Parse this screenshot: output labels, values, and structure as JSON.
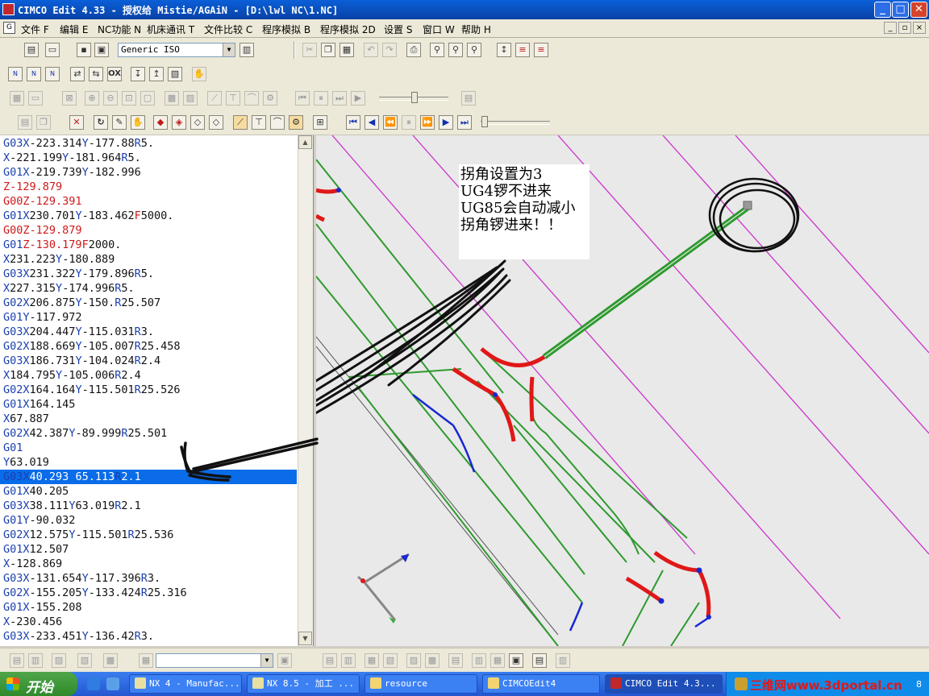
{
  "window": {
    "title": "CIMCO Edit 4.33 - 授权给 Mistie/AGAiN - [D:\\lwl NC\\1.NC]",
    "controls": {
      "minimize": "_",
      "maximize": "□",
      "close": "✕"
    }
  },
  "menubar": {
    "items": [
      "文件 F",
      "编辑 E",
      "NC功能 N",
      "机床通讯 T",
      "文件比较 C",
      "程序模拟 B",
      "程序模拟 2D",
      "设置 S",
      "窗口 W",
      "帮助 H"
    ]
  },
  "toolbar": {
    "machine_select": "Generic ISO",
    "bottom_combo": ""
  },
  "editor": {
    "selected_index": 23,
    "lines": [
      [
        [
          "G03",
          "b"
        ],
        [
          "X",
          "b"
        ],
        [
          "-223.314",
          "n"
        ],
        [
          "Y",
          "b"
        ],
        [
          "-177.88",
          "n"
        ],
        [
          "R",
          "b"
        ],
        [
          "5.",
          "n"
        ]
      ],
      [
        [
          "X",
          "b"
        ],
        [
          "-221.199",
          "n"
        ],
        [
          "Y",
          "b"
        ],
        [
          "-181.964",
          "n"
        ],
        [
          "R",
          "b"
        ],
        [
          "5.",
          "n"
        ]
      ],
      [
        [
          "G01",
          "b"
        ],
        [
          "X",
          "b"
        ],
        [
          "-219.739",
          "n"
        ],
        [
          "Y",
          "b"
        ],
        [
          "-182.996",
          "n"
        ]
      ],
      [
        [
          "Z",
          "r"
        ],
        [
          "-129.879",
          "r"
        ]
      ],
      [
        [
          "G00",
          "r"
        ],
        [
          "Z",
          "r"
        ],
        [
          "-129.391",
          "r"
        ]
      ],
      [
        [
          "G01",
          "b"
        ],
        [
          "X",
          "b"
        ],
        [
          "230.701",
          "n"
        ],
        [
          "Y",
          "b"
        ],
        [
          "-183.462",
          "n"
        ],
        [
          "F",
          "r"
        ],
        [
          "5000.",
          "n"
        ]
      ],
      [
        [
          "G00",
          "r"
        ],
        [
          "Z",
          "r"
        ],
        [
          "-129.879",
          "r"
        ]
      ],
      [
        [
          "G01",
          "b"
        ],
        [
          "Z",
          "r"
        ],
        [
          "-130.179",
          "r"
        ],
        [
          "F",
          "r"
        ],
        [
          "2000.",
          "n"
        ]
      ],
      [
        [
          "X",
          "b"
        ],
        [
          "231.223",
          "n"
        ],
        [
          "Y",
          "b"
        ],
        [
          "-180.889",
          "n"
        ]
      ],
      [
        [
          "G03",
          "b"
        ],
        [
          "X",
          "b"
        ],
        [
          "231.322",
          "n"
        ],
        [
          "Y",
          "b"
        ],
        [
          "-179.896",
          "n"
        ],
        [
          "R",
          "b"
        ],
        [
          "5.",
          "n"
        ]
      ],
      [
        [
          "X",
          "b"
        ],
        [
          "227.315",
          "n"
        ],
        [
          "Y",
          "b"
        ],
        [
          "-174.996",
          "n"
        ],
        [
          "R",
          "b"
        ],
        [
          "5.",
          "n"
        ]
      ],
      [
        [
          "G02",
          "b"
        ],
        [
          "X",
          "b"
        ],
        [
          "206.875",
          "n"
        ],
        [
          "Y",
          "b"
        ],
        [
          "-150.",
          "n"
        ],
        [
          "R",
          "b"
        ],
        [
          "25.507",
          "n"
        ]
      ],
      [
        [
          "G01",
          "b"
        ],
        [
          "Y",
          "b"
        ],
        [
          "-117.972",
          "n"
        ]
      ],
      [
        [
          "G03",
          "b"
        ],
        [
          "X",
          "b"
        ],
        [
          "204.447",
          "n"
        ],
        [
          "Y",
          "b"
        ],
        [
          "-115.031",
          "n"
        ],
        [
          "R",
          "b"
        ],
        [
          "3.",
          "n"
        ]
      ],
      [
        [
          "G02",
          "b"
        ],
        [
          "X",
          "b"
        ],
        [
          "188.669",
          "n"
        ],
        [
          "Y",
          "b"
        ],
        [
          "-105.007",
          "n"
        ],
        [
          "R",
          "b"
        ],
        [
          "25.458",
          "n"
        ]
      ],
      [
        [
          "G03",
          "b"
        ],
        [
          "X",
          "b"
        ],
        [
          "186.731",
          "n"
        ],
        [
          "Y",
          "b"
        ],
        [
          "-104.024",
          "n"
        ],
        [
          "R",
          "b"
        ],
        [
          "2.4",
          "n"
        ]
      ],
      [
        [
          "X",
          "b"
        ],
        [
          "184.795",
          "n"
        ],
        [
          "Y",
          "b"
        ],
        [
          "-105.006",
          "n"
        ],
        [
          "R",
          "b"
        ],
        [
          "2.4",
          "n"
        ]
      ],
      [
        [
          "G02",
          "b"
        ],
        [
          "X",
          "b"
        ],
        [
          "164.164",
          "n"
        ],
        [
          "Y",
          "b"
        ],
        [
          "-115.501",
          "n"
        ],
        [
          "R",
          "b"
        ],
        [
          "25.526",
          "n"
        ]
      ],
      [
        [
          "G01",
          "b"
        ],
        [
          "X",
          "b"
        ],
        [
          "164.145",
          "n"
        ]
      ],
      [
        [
          "X",
          "b"
        ],
        [
          "67.887",
          "n"
        ]
      ],
      [
        [
          "G02",
          "b"
        ],
        [
          "X",
          "b"
        ],
        [
          "42.387",
          "n"
        ],
        [
          "Y",
          "b"
        ],
        [
          "-89.999",
          "n"
        ],
        [
          "R",
          "b"
        ],
        [
          "25.501",
          "n"
        ]
      ],
      [
        [
          "G01",
          "b"
        ]
      ],
      [
        [
          "Y",
          "b"
        ],
        [
          "63.019",
          "n"
        ]
      ],
      [
        [
          "G03",
          "b"
        ],
        [
          "X",
          "b"
        ],
        [
          "40.293",
          "n"
        ],
        [
          " ",
          "n"
        ],
        [
          "65.113",
          "n"
        ],
        [
          "R",
          "b"
        ],
        [
          "2.1",
          "n"
        ]
      ],
      [
        [
          "G01",
          "b"
        ],
        [
          "X",
          "b"
        ],
        [
          "40.205",
          "n"
        ]
      ],
      [
        [
          "G03",
          "b"
        ],
        [
          "X",
          "b"
        ],
        [
          "38.111",
          "n"
        ],
        [
          "Y",
          "b"
        ],
        [
          "63.019",
          "n"
        ],
        [
          "R",
          "b"
        ],
        [
          "2.1",
          "n"
        ]
      ],
      [
        [
          "G01",
          "b"
        ],
        [
          "Y",
          "b"
        ],
        [
          "-90.032",
          "n"
        ]
      ],
      [
        [
          "G02",
          "b"
        ],
        [
          "X",
          "b"
        ],
        [
          "12.575",
          "n"
        ],
        [
          "Y",
          "b"
        ],
        [
          "-115.501",
          "n"
        ],
        [
          "R",
          "b"
        ],
        [
          "25.536",
          "n"
        ]
      ],
      [
        [
          "G01",
          "b"
        ],
        [
          "X",
          "b"
        ],
        [
          "12.507",
          "n"
        ]
      ],
      [
        [
          "X",
          "b"
        ],
        [
          "-128.869",
          "n"
        ]
      ],
      [
        [
          "G03",
          "b"
        ],
        [
          "X",
          "b"
        ],
        [
          "-131.654",
          "n"
        ],
        [
          "Y",
          "b"
        ],
        [
          "-117.396",
          "n"
        ],
        [
          "R",
          "b"
        ],
        [
          "3.",
          "n"
        ]
      ],
      [
        [
          "G02",
          "b"
        ],
        [
          "X",
          "b"
        ],
        [
          "-155.205",
          "n"
        ],
        [
          "Y",
          "b"
        ],
        [
          "-133.424",
          "n"
        ],
        [
          "R",
          "b"
        ],
        [
          "25.316",
          "n"
        ]
      ],
      [
        [
          "G01",
          "b"
        ],
        [
          "X",
          "b"
        ],
        [
          "-155.208",
          "n"
        ]
      ],
      [
        [
          "X",
          "b"
        ],
        [
          "-230.456",
          "n"
        ]
      ],
      [
        [
          "G03",
          "b"
        ],
        [
          "X",
          "b"
        ],
        [
          "-233.451",
          "n"
        ],
        [
          "Y",
          "b"
        ],
        [
          "-136.42",
          "n"
        ],
        [
          "R",
          "b"
        ],
        [
          "3.",
          "n"
        ]
      ]
    ]
  },
  "annotation": {
    "lines": [
      "拐角设置为3",
      "UG4锣不进来",
      "UG85会自动减小",
      "拐角锣进来！！"
    ]
  },
  "taskbar": {
    "start_label": "开始",
    "tasks": [
      "NX 4 - Manufac...",
      "NX 8.5 - 加工 ...",
      "resource",
      "CIMCOEdit4",
      "CIMCO Edit 4.3..."
    ],
    "watermark": "三维网www.3dportal.cn",
    "clock": "8"
  },
  "colors": {
    "code_blue": "#1a3fb0",
    "code_red": "#d01818",
    "selection": "#0a6ce8",
    "toolpath_green": "#2e9a2e",
    "toolpath_red": "#e01818",
    "toolpath_blue": "#1828d0",
    "boundary_magenta": "#cc33cc"
  }
}
